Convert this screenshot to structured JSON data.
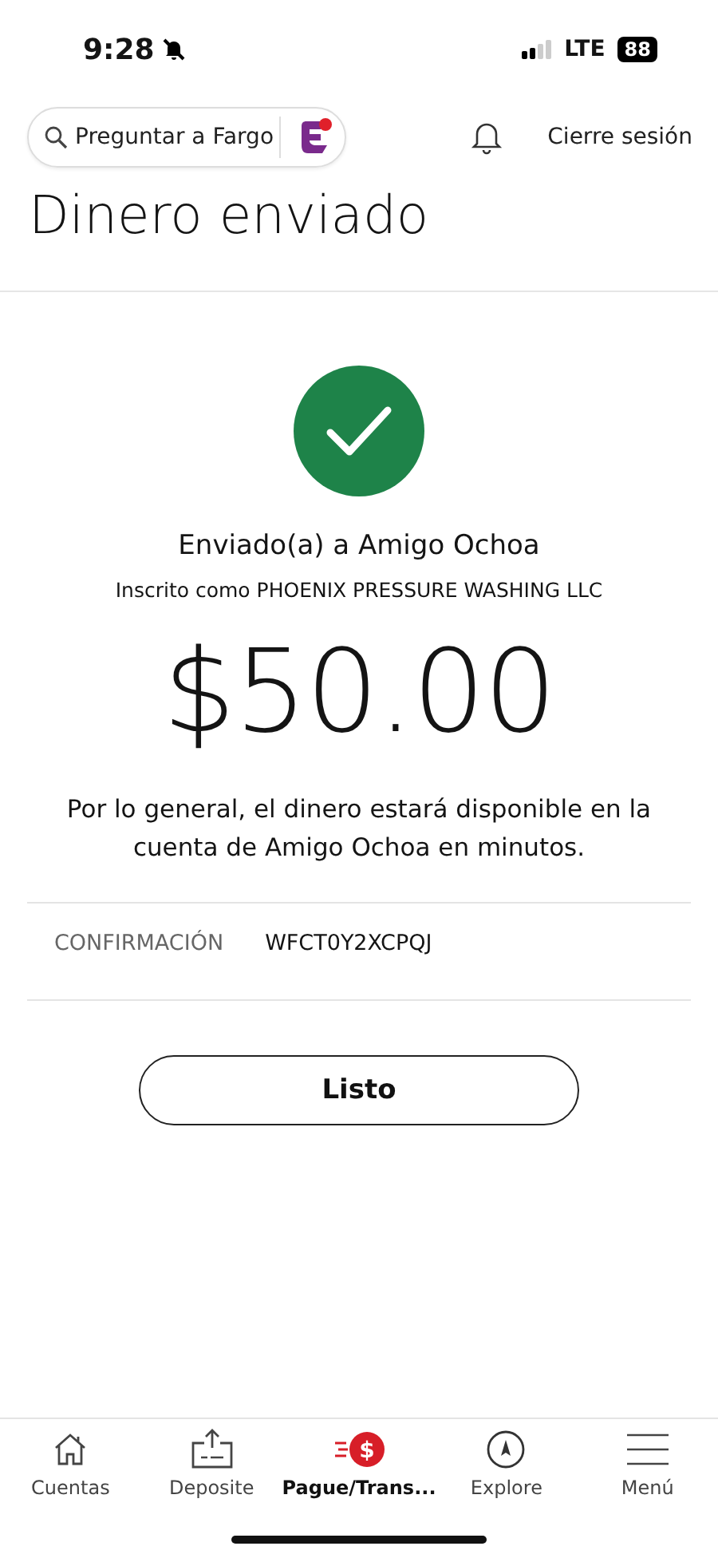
{
  "status_bar": {
    "time": "9:28",
    "network": "LTE",
    "battery": "88"
  },
  "header": {
    "search": {
      "placeholder": "Preguntar a Fargo"
    },
    "sign_out": "Cierre sesión"
  },
  "title": "Dinero enviado",
  "confirmation": {
    "recipient": "Enviado(a) a Amigo Ochoa",
    "enrolled_as": "Inscrito como PHOENIX PRESSURE WASHING LLC",
    "amount": "$50.00",
    "message": "Por lo general, el dinero estará disponible en la cuenta de Amigo Ochoa en minutos.",
    "code_label": "CONFIRMACIÓN",
    "code": "WFCT0Y2XCPQJ",
    "button": "Listo"
  },
  "tab_bar": [
    {
      "kind": "home",
      "label": "Cuentas",
      "selected": false
    },
    {
      "kind": "deposit",
      "label": "Deposite",
      "selected": false
    },
    {
      "kind": "pay",
      "icon_text": "$",
      "label": "Pague/Trans...",
      "selected": true
    },
    {
      "kind": "explore",
      "label": "Explore",
      "selected": false
    },
    {
      "kind": "menu",
      "label": "Menú",
      "selected": false
    }
  ]
}
